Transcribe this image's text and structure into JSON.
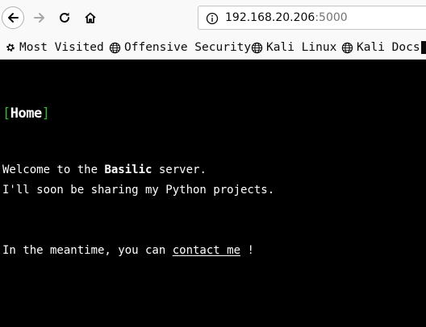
{
  "browser": {
    "url_host": "192.168.20.206",
    "url_port": ":5000",
    "bookmarks": [
      {
        "label": "Most Visited",
        "icon": "gear-icon"
      },
      {
        "label": "Offensive Security",
        "icon": "globe-icon"
      },
      {
        "label": "Kali Linux",
        "icon": "globe-icon"
      },
      {
        "label": "Kali Docs",
        "icon": "globe-icon"
      }
    ]
  },
  "page": {
    "nav": {
      "open_bracket": "[",
      "home_label": "Home",
      "close_bracket": "]"
    },
    "welcome_prefix": "Welcome to the ",
    "server_name": "Basilic",
    "welcome_suffix": " server.",
    "line2": "I'll soon be sharing my Python projects.",
    "meantime_prefix": "In the meantime, you can ",
    "contact_label": "contact me",
    "meantime_suffix": " !"
  },
  "colors": {
    "background": "#000000",
    "text": "#ffffff",
    "bracket": "#22c322"
  }
}
